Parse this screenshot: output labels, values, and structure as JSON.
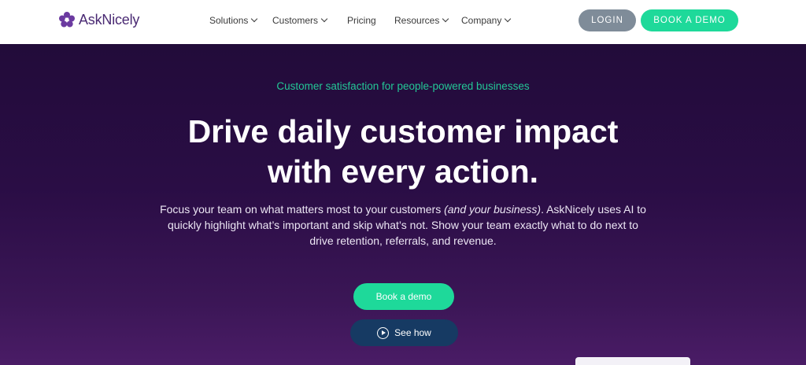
{
  "brand": {
    "name": "AskNicely",
    "color": "#4a2a73",
    "flower_color": "#6b3aa0"
  },
  "nav": {
    "items": [
      {
        "label": "Solutions",
        "has_dropdown": true
      },
      {
        "label": "Customers",
        "has_dropdown": true
      },
      {
        "label": "Pricing",
        "has_dropdown": false
      },
      {
        "label": "Resources",
        "has_dropdown": true
      },
      {
        "label": "Company",
        "has_dropdown": true
      }
    ],
    "login_label": "LOGIN",
    "demo_label": "BOOK A DEMO"
  },
  "hero": {
    "eyebrow": "Customer satisfaction for people-powered businesses",
    "headline_line1": "Drive daily customer impact",
    "headline_line2": "with every action.",
    "body_part1": "Focus your team on what matters most to your customers ",
    "body_italic": "(and your business)",
    "body_part2": ". AskNicely uses AI to quickly highlight what’s important and skip what’s not. Show your team exactly what to do next to drive retention, referrals, and revenue.",
    "cta_primary": "Book a demo",
    "cta_secondary": "See how"
  },
  "colors": {
    "accent_green": "#1ed99a",
    "login_gray": "#7f8c99",
    "hero_bg": "#2a0d45",
    "secondary_btn": "#163a63"
  }
}
